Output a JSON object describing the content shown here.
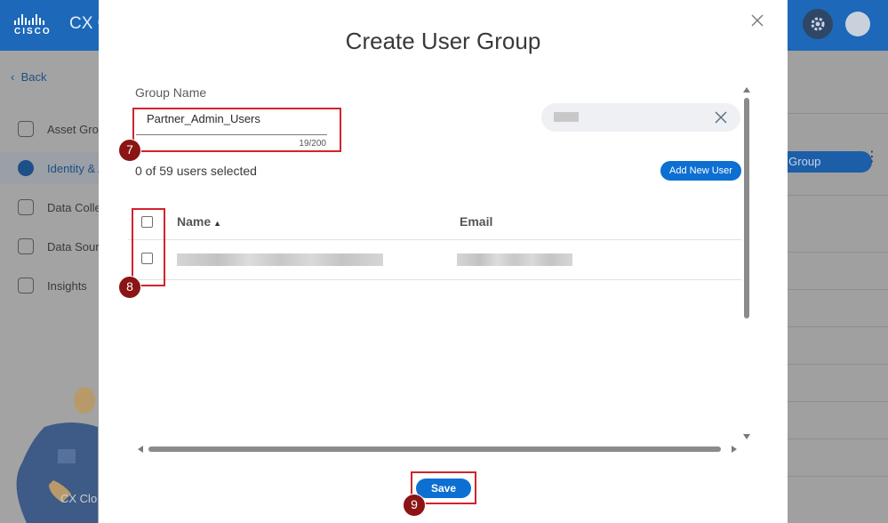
{
  "app": {
    "brand": "CISCO",
    "title_partial": "CX C",
    "back_label": "Back",
    "sidebar": [
      {
        "label": "Asset Grou",
        "icon": "asset-icon"
      },
      {
        "label": "Identity & A",
        "icon": "identity-icon",
        "active": true
      },
      {
        "label": "Data Colle",
        "icon": "data-collection-icon"
      },
      {
        "label": "Data Sourc",
        "icon": "database-icon"
      },
      {
        "label": "Insights",
        "icon": "insights-icon"
      }
    ],
    "mascot_label": "CX Clo",
    "right_button_partial": "er Group"
  },
  "modal": {
    "title": "Create User Group",
    "group_name_label": "Group Name",
    "group_name_value": "Partner_Admin_Users",
    "group_name_counter": "19/200",
    "selected_count": "0 of 59 users selected",
    "add_user_label": "Add New User",
    "table": {
      "col_name": "Name",
      "col_email": "Email",
      "sort_indicator": "▲"
    },
    "save_label": "Save"
  },
  "annotations": {
    "badge_7": "7",
    "badge_8": "8",
    "badge_9": "9"
  },
  "colors": {
    "topbar": "#1d68b8",
    "primary_button": "#0d6fd2",
    "highlight": "#d0242d",
    "badge": "#8b1414"
  }
}
